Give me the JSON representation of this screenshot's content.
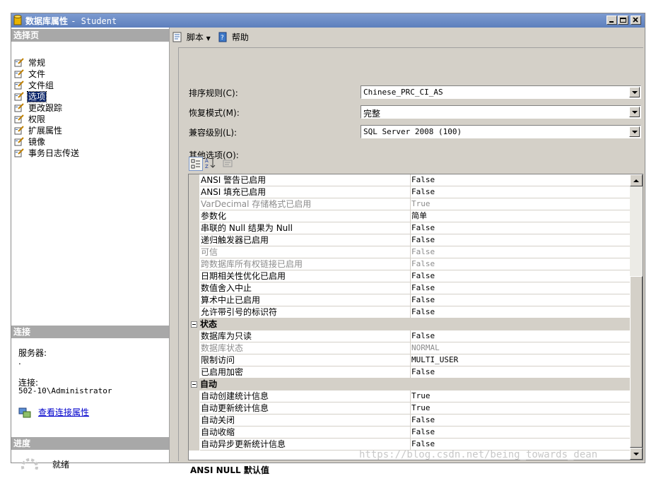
{
  "window": {
    "title": "数据库属性",
    "subtitle": "- Student"
  },
  "left_panel": {
    "pages_header": "选择页",
    "pages": [
      {
        "label": "常规"
      },
      {
        "label": "文件"
      },
      {
        "label": "文件组"
      },
      {
        "label": "选项",
        "selected": true
      },
      {
        "label": "更改跟踪"
      },
      {
        "label": "权限"
      },
      {
        "label": "扩展属性"
      },
      {
        "label": "镜像"
      },
      {
        "label": "事务日志传送"
      }
    ],
    "connection_header": "连接",
    "server_label": "服务器:",
    "server_value": ".",
    "connection_label": "连接:",
    "connection_value": "502-10\\Administrator",
    "view_connection_link": "查看连接属性",
    "progress_header": "进度",
    "progress_status": "就绪"
  },
  "toolbar": {
    "script_label": "脚本",
    "help_label": "帮助"
  },
  "form": {
    "collation_label": "排序规则(C):",
    "collation_value": "Chinese_PRC_CI_AS",
    "recovery_label": "恢复模式(M):",
    "recovery_value": "完整",
    "compat_label": "兼容级别(L):",
    "compat_value": "SQL Server 2008 (100)",
    "other_options_label": "其他选项(O):"
  },
  "properties": {
    "rows": [
      {
        "name": "ANSI 警告已启用",
        "value": "False"
      },
      {
        "name": "ANSI 填充已启用",
        "value": "False"
      },
      {
        "name": "VarDecimal 存储格式已启用",
        "value": "True",
        "disabled": true
      },
      {
        "name": "参数化",
        "value": "简单"
      },
      {
        "name": "串联的 Null 结果为 Null",
        "value": "False"
      },
      {
        "name": "递归触发器已启用",
        "value": "False"
      },
      {
        "name": "可信",
        "value": "False",
        "disabled": true
      },
      {
        "name": "跨数据库所有权链接已启用",
        "value": "False",
        "disabled": true
      },
      {
        "name": "日期相关性优化已启用",
        "value": "False"
      },
      {
        "name": "数值舍入中止",
        "value": "False"
      },
      {
        "name": "算术中止已启用",
        "value": "False"
      },
      {
        "name": "允许带引号的标识符",
        "value": "False"
      },
      {
        "category": "状态"
      },
      {
        "name": "数据库为只读",
        "value": "False"
      },
      {
        "name": "数据库状态",
        "value": "NORMAL",
        "disabled": true
      },
      {
        "name": "限制访问",
        "value": "MULTI_USER"
      },
      {
        "name": "已启用加密",
        "value": "False"
      },
      {
        "category": "自动"
      },
      {
        "name": "自动创建统计信息",
        "value": "True"
      },
      {
        "name": "自动更新统计信息",
        "value": "True"
      },
      {
        "name": "自动关闭",
        "value": "False"
      },
      {
        "name": "自动收缩",
        "value": "False"
      },
      {
        "name": "自动异步更新统计信息",
        "value": "False"
      }
    ],
    "description": "ANSI NULL 默认值"
  },
  "watermark": "https://blog.csdn.net/being_towards_dean"
}
